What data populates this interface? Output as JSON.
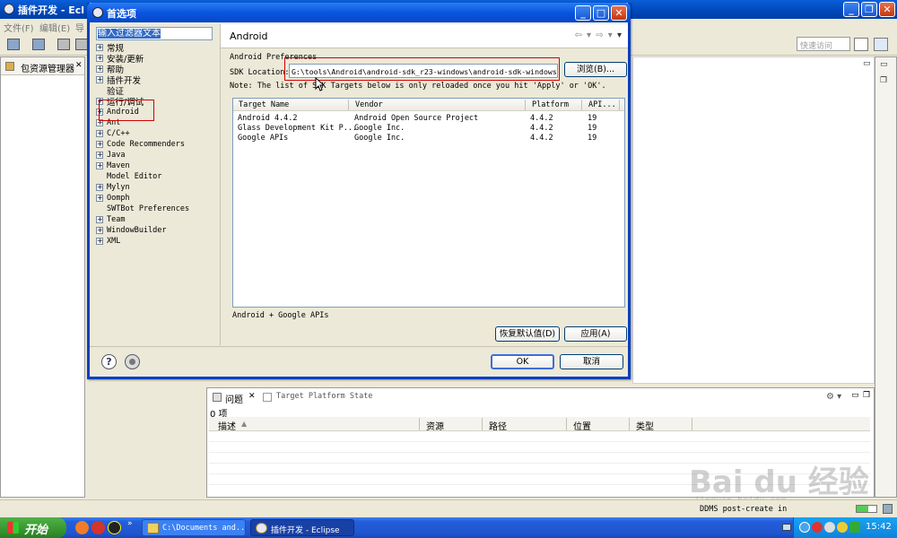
{
  "eclipse": {
    "title": "插件开发 - Ecl",
    "menu": [
      "文件(F)",
      "编辑(E)",
      "导"
    ],
    "quick_access": "快速访问",
    "package_explorer_tab": "包资源管理器",
    "problems_tab": "问题",
    "target_platform_tab": "Target Platform State",
    "problems_count": "0 项",
    "problems_columns": [
      "描述",
      "资源",
      "路径",
      "位置",
      "类型"
    ]
  },
  "dialog": {
    "title": "首选项",
    "filter_text": "输入过滤器文本",
    "tree": [
      {
        "label": "常规",
        "expandable": true
      },
      {
        "label": "安装/更新",
        "expandable": true
      },
      {
        "label": "帮助",
        "expandable": true
      },
      {
        "label": "插件开发",
        "expandable": true
      },
      {
        "label": "验证",
        "expandable": false
      },
      {
        "label": "运行/调试",
        "expandable": true
      },
      {
        "label": "Android",
        "expandable": true
      },
      {
        "label": "Ant",
        "expandable": true
      },
      {
        "label": "C/C++",
        "expandable": true
      },
      {
        "label": "Code Recommenders",
        "expandable": true
      },
      {
        "label": "Java",
        "expandable": true
      },
      {
        "label": "Maven",
        "expandable": true
      },
      {
        "label": "Model Editor",
        "expandable": false
      },
      {
        "label": "Mylyn",
        "expandable": true
      },
      {
        "label": "Oomph",
        "expandable": true
      },
      {
        "label": "SWTBot Preferences",
        "expandable": false
      },
      {
        "label": "Team",
        "expandable": true
      },
      {
        "label": "WindowBuilder",
        "expandable": true
      },
      {
        "label": "XML",
        "expandable": true
      }
    ],
    "page_title": "Android",
    "page_subtitle": "Android Preferences",
    "sdk_label": "SDK Location:",
    "sdk_value": "G:\\tools\\Android\\android-sdk_r23-windows\\android-sdk-windows",
    "browse_label": "浏览(B)...",
    "note": "Note: The list of SDK Targets below is only reloaded once you hit 'Apply' or 'OK'.",
    "table": {
      "columns": [
        "Target Name",
        "Vendor",
        "Platform",
        "API..."
      ],
      "rows": [
        [
          "Android 4.4.2",
          "Android Open Source Project",
          "4.4.2",
          "19"
        ],
        [
          "Glass Development Kit P...",
          "Google Inc.",
          "4.4.2",
          "19"
        ],
        [
          "Google APIs",
          "Google Inc.",
          "4.4.2",
          "19"
        ]
      ]
    },
    "summary": "Android + Google APIs",
    "restore_defaults": "恢复默认值(D)",
    "apply": "应用(A)",
    "ok": "OK",
    "cancel": "取消"
  },
  "statusbar": {
    "text": "DDMS post-create in"
  },
  "watermark": {
    "main": "Bai du 经验",
    "sub": "jingyan.baidu.com"
  },
  "taskbar": {
    "start": "开始",
    "tasks": [
      "C:\\Documents and...",
      "插件开发 - Eclipse"
    ],
    "clock": "15:42"
  },
  "colors": {
    "highlight_box": "#d40000",
    "xp_blue": "#0a56df",
    "start_green": "#34902d"
  }
}
